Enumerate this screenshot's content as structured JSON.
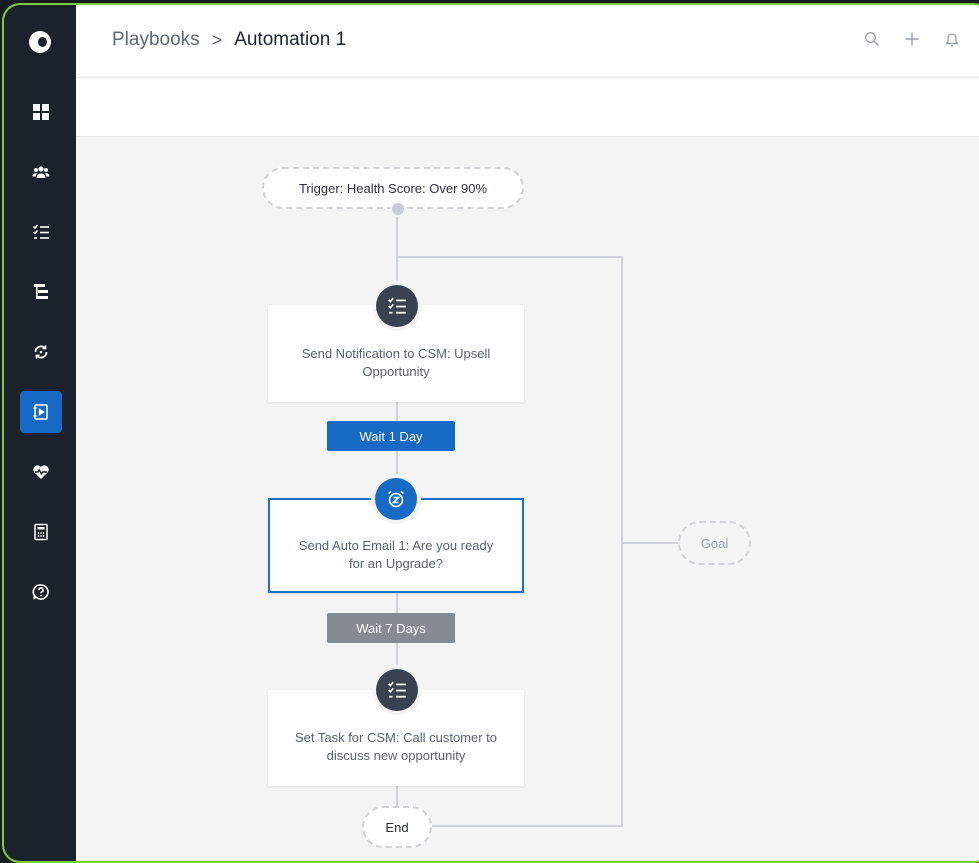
{
  "breadcrumb": {
    "root": "Playbooks",
    "separator": ">",
    "current": "Automation 1"
  },
  "top_actions": [
    "search-icon",
    "plus-icon",
    "bell-icon"
  ],
  "sidebar": {
    "logo": "logo-icon",
    "items": [
      {
        "icon": "dashboard-icon",
        "active": false
      },
      {
        "icon": "users-icon",
        "active": false
      },
      {
        "icon": "checklist-icon",
        "active": false
      },
      {
        "icon": "hierarchy-icon",
        "active": false
      },
      {
        "icon": "refresh-icon",
        "active": false
      },
      {
        "icon": "playbook-icon",
        "active": true
      },
      {
        "icon": "heart-pulse-icon",
        "active": false
      },
      {
        "icon": "calculator-icon",
        "active": false
      },
      {
        "icon": "help-icon",
        "active": false
      }
    ]
  },
  "flow": {
    "trigger": "Trigger: Health Score: Over 90%",
    "steps": [
      {
        "text": "Send Notification to CSM: Upsell Opportunity",
        "icon": "checklist-icon",
        "selected": false
      },
      {
        "text": "Send Auto Email 1: Are you ready for an Upgrade?",
        "icon": "alarm-clock-icon",
        "selected": true
      },
      {
        "text": "Set Task for CSM: Call customer to discuss new opportunity",
        "icon": "checklist-icon",
        "selected": false
      }
    ],
    "waits": [
      {
        "label": "Wait 1 Day",
        "style": "active"
      },
      {
        "label": "Wait 7 Days",
        "style": "inactive"
      }
    ],
    "goal": "Goal",
    "end": "End"
  },
  "colors": {
    "accent": "#1769c6",
    "sidebar_bg": "#1b222b",
    "frame_border": "#7ccb3a",
    "canvas_bg": "#f4f4f5"
  }
}
